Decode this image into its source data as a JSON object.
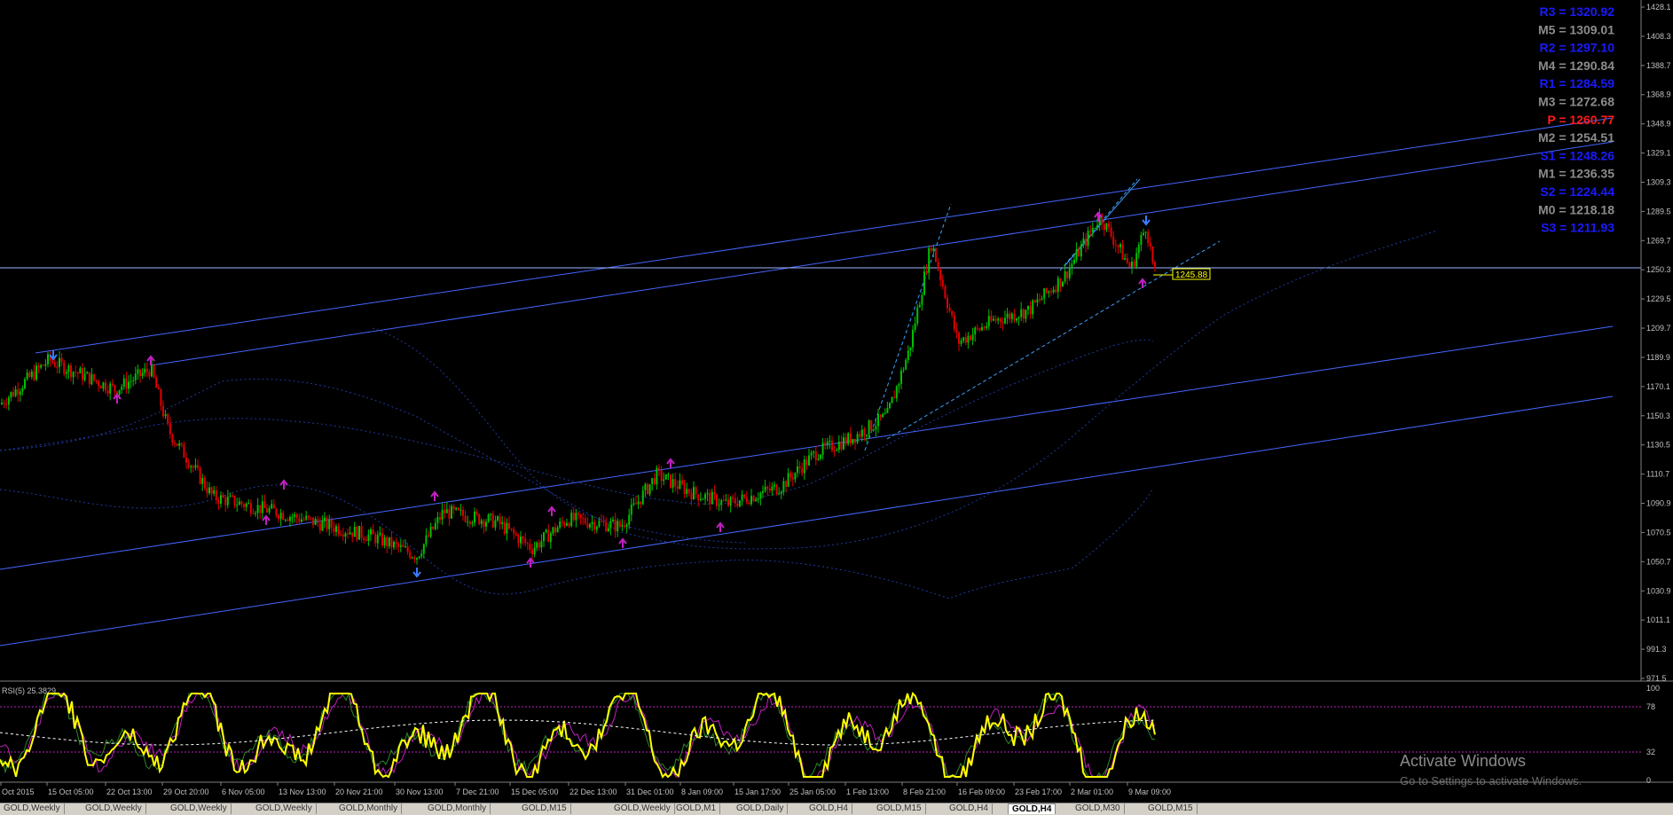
{
  "window": {
    "symbol": "GOLD",
    "timeframe": "H4",
    "current_price": "1245.88",
    "current_price_line": "1250.3"
  },
  "pivots": [
    {
      "label": "R3 = 1320.92",
      "kind": "resistance"
    },
    {
      "label": "M5 = 1309.01",
      "kind": "mid"
    },
    {
      "label": "R2 = 1297.10",
      "kind": "resistance"
    },
    {
      "label": "M4 = 1290.84",
      "kind": "mid"
    },
    {
      "label": "R1 = 1284.59",
      "kind": "resistance"
    },
    {
      "label": "M3 = 1272.68",
      "kind": "mid"
    },
    {
      "label": "P  = 1260.77",
      "kind": "pivot"
    },
    {
      "label": "M2 = 1254.51",
      "kind": "mid"
    },
    {
      "label": "S1 = 1248.26",
      "kind": "support"
    },
    {
      "label": "M1 = 1236.35",
      "kind": "mid"
    },
    {
      "label": "S2 = 1224.44",
      "kind": "support"
    },
    {
      "label": "M0 = 1218.18",
      "kind": "mid"
    },
    {
      "label": "S3 = 1211.93",
      "kind": "support"
    }
  ],
  "price_axis": [
    "1428.1",
    "1408.3",
    "1388.7",
    "1368.9",
    "1348.9",
    "1329.1",
    "1309.3",
    "1289.5",
    "1269.7",
    "1250.3",
    "1229.5",
    "1209.7",
    "1189.9",
    "1170.1",
    "1150.3",
    "1130.5",
    "1110.7",
    "1090.9",
    "1070.5",
    "1050.7",
    "1030.9",
    "1011.1",
    "991.3",
    "971.5"
  ],
  "rsi": {
    "label": "RSI(5) 25.3829",
    "levels": [
      "100",
      "78",
      "32",
      "0"
    ]
  },
  "time_axis": [
    "Oct 2015",
    "15 Oct 05:00",
    "22 Oct 13:00",
    "29 Oct 20:00",
    "6 Nov 05:00",
    "13 Nov 13:00",
    "20 Nov 21:00",
    "30 Nov 13:00",
    "7 Dec 21:00",
    "15 Dec 05:00",
    "22 Dec 13:00",
    "31 Dec 01:00",
    "8 Jan 09:00",
    "15 Jan 17:00",
    "25 Jan 05:00",
    "1 Feb 13:00",
    "8 Feb 21:00",
    "16 Feb 09:00",
    "23 Feb 17:00",
    "2 Mar 01:00",
    "9 Mar 09:00"
  ],
  "watermark": {
    "title": "Activate Windows",
    "subtitle": "Go to Settings to activate Windows."
  },
  "tabs": [
    {
      "label": "GOLD,Weekly",
      "active": false
    },
    {
      "label": "GOLD,Weekly",
      "active": false
    },
    {
      "label": "GOLD,Weekly",
      "active": false
    },
    {
      "label": "GOLD,Weekly",
      "active": false
    },
    {
      "label": "GOLD,Monthly",
      "active": false
    },
    {
      "label": "GOLD,Monthly",
      "active": false
    },
    {
      "label": "GOLD,M15",
      "active": false
    },
    {
      "label": "GOLD,Weekly",
      "active": false
    },
    {
      "label": "GOLD,M1",
      "active": false
    },
    {
      "label": "GOLD,Daily",
      "active": false
    },
    {
      "label": "GOLD,H4",
      "active": false
    },
    {
      "label": "GOLD,M15",
      "active": false
    },
    {
      "label": "GOLD,H4",
      "active": false
    },
    {
      "label": "GOLD,H4",
      "active": true
    },
    {
      "label": "GOLD,M30",
      "active": false
    },
    {
      "label": "GOLD,M15",
      "active": false
    }
  ],
  "colors": {
    "background": "#000000",
    "bull": "#00c000",
    "bear": "#e00000",
    "channel": "#4466ff",
    "dotted": "#1e3aa0",
    "pivot_resistance": "#0000ff",
    "pivot_support": "#0000ff",
    "pivot_mid": "#8c8c8c",
    "pivot_p": "#ff0000",
    "rsi": "#ffff00",
    "axis_text": "#c0c0c0"
  }
}
